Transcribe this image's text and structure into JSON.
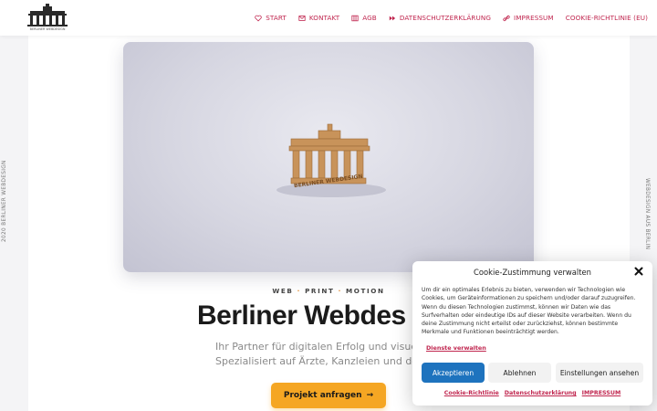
{
  "header": {
    "logo_text": "BERLINER WEBDESIGN",
    "nav": [
      {
        "label": "START",
        "icon": "heart-icon"
      },
      {
        "label": "KONTAKT",
        "icon": "mail-icon"
      },
      {
        "label": "AGB",
        "icon": "grid-icon"
      },
      {
        "label": "DATENSCHUTZERKLÄRUNG",
        "icon": "fast-forward-icon"
      },
      {
        "label": "IMPRESSUM",
        "icon": "link-icon"
      },
      {
        "label": "COOKIE-RICHTLINIE (EU)",
        "icon": ""
      }
    ]
  },
  "side": {
    "left": "2020 BERLINER WEBDESIGN",
    "right": "WEBDESIGN AUS BERLIN"
  },
  "hero": {
    "model_text": "BERLINER WEBDESIGN",
    "kicker": [
      "WEB",
      "PRINT",
      "MOTION"
    ],
    "kicker_sep": "·",
    "headline": "Berliner Webdes",
    "sub_line1": "Ihr Partner für digitalen Erfolg und visuelle Ide",
    "sub_line2": "Spezialisiert auf Ärzte, Kanzleien und den Mitt",
    "cta_label": "Projekt anfragen",
    "cta_arrow": "→"
  },
  "cookie": {
    "title": "Cookie-Zustimmung verwalten",
    "body": "Um dir ein optimales Erlebnis zu bieten, verwenden wir Technologien wie Cookies, um Geräteinformationen zu speichern und/oder darauf zuzugreifen. Wenn du diesen Technologien zustimmst, können wir Daten wie das Surfverhalten oder eindeutige IDs auf dieser Website verarbeiten. Wenn du deine Zustimmung nicht erteilst oder zurückziehst, können bestimmte Merkmale und Funktionen beeinträchtigt werden.",
    "manage_link": "Dienste verwalten",
    "accept": "Akzeptieren",
    "deny": "Ablehnen",
    "settings": "Einstellungen ansehen",
    "links": [
      "Cookie-Richtlinie",
      "Datenschutzerklärung",
      "IMPRESSUM"
    ]
  },
  "colors": {
    "accent": "#c0264f",
    "cta": "#f5a623",
    "primary_button": "#1e73be"
  }
}
